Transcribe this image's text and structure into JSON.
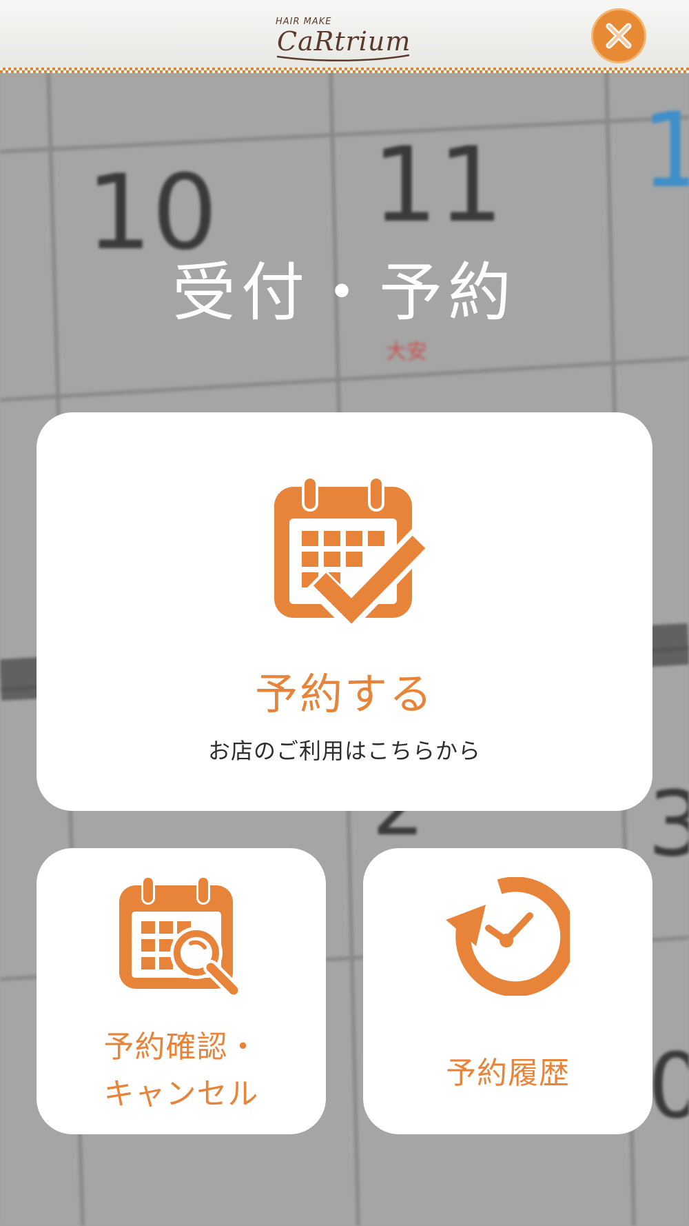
{
  "header": {
    "logo_small": "HAIR MAKE",
    "logo_text": "CaRtrium",
    "close_label": "close"
  },
  "page": {
    "title": "受付・予約"
  },
  "cards": {
    "reserve": {
      "label": "予約する",
      "sub": "お店のご利用はこちらから",
      "icon": "calendar-check-icon"
    },
    "check_cancel": {
      "label_line1": "予約確認・",
      "label_line2": "キャンセル",
      "icon": "calendar-search-icon"
    },
    "history": {
      "label": "予約履歴",
      "icon": "history-clock-icon"
    }
  },
  "colors": {
    "accent": "#e8843a",
    "header_stripe": "#d9893a",
    "card_bg": "#ffffff"
  }
}
